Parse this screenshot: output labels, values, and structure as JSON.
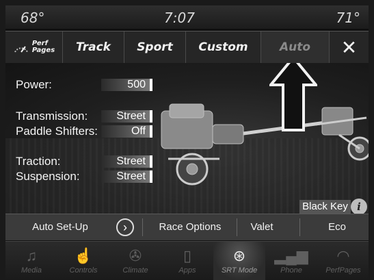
{
  "status": {
    "temp_left": "68°",
    "time": "7:07",
    "temp_right": "71°"
  },
  "tabs": {
    "perf_line1": "Perf",
    "perf_line2": "Pages",
    "track": "Track",
    "sport": "Sport",
    "custom": "Custom",
    "auto": "Auto",
    "close": "✕"
  },
  "settings": {
    "power_label": "Power:",
    "power_value": "500",
    "transmission_label": "Transmission:",
    "transmission_value": "Street",
    "paddle_label": "Paddle Shifters:",
    "paddle_value": "Off",
    "traction_label": "Traction:",
    "traction_value": "Street",
    "suspension_label": "Suspension:",
    "suspension_value": "Street"
  },
  "black_key": "Black Key",
  "info_glyph": "i",
  "options": {
    "auto_setup": "Auto Set-Up",
    "chevron": "›",
    "race_options": "Race Options",
    "valet": "Valet",
    "eco": "Eco"
  },
  "nav": [
    {
      "label": "Media",
      "icon": "music-note-icon"
    },
    {
      "label": "Controls",
      "icon": "hand-touch-icon"
    },
    {
      "label": "Climate",
      "icon": "fan-icon"
    },
    {
      "label": "Apps",
      "icon": "apps-icon"
    },
    {
      "label": "SRT Mode",
      "icon": "steering-wheel-icon"
    },
    {
      "label": "Phone",
      "icon": "phone-signal-icon"
    },
    {
      "label": "PerfPages",
      "icon": "gauge-icon"
    }
  ]
}
